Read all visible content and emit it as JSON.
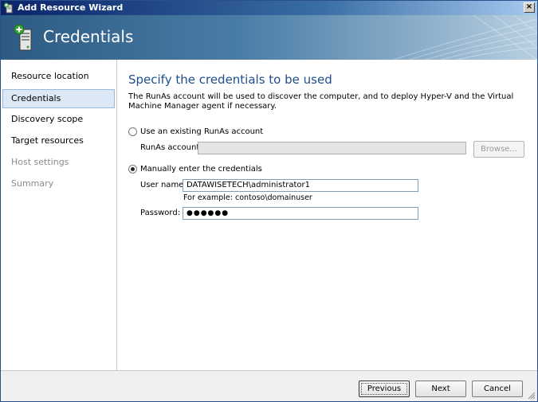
{
  "window": {
    "title": "Add Resource Wizard",
    "close_glyph": "×",
    "icon": "server-add-icon"
  },
  "header": {
    "title": "Credentials",
    "icon": "server-add-icon"
  },
  "sidebar": {
    "items": [
      {
        "label": "Resource location",
        "state": "normal"
      },
      {
        "label": "Credentials",
        "state": "selected"
      },
      {
        "label": "Discovery scope",
        "state": "normal"
      },
      {
        "label": "Target resources",
        "state": "normal"
      },
      {
        "label": "Host settings",
        "state": "disabled"
      },
      {
        "label": "Summary",
        "state": "disabled"
      }
    ]
  },
  "main": {
    "title": "Specify the credentials to be used",
    "description": "The RunAs account will be used to discover the computer, and to deploy Hyper-V and the Virtual Machine Manager agent if necessary.",
    "option_existing": {
      "label": "Use an existing RunAs account",
      "checked": false
    },
    "runas_account": {
      "label": "RunAs account:",
      "value": ""
    },
    "browse_label": "Browse...",
    "option_manual": {
      "label": "Manually enter the credentials",
      "checked": true
    },
    "user_name": {
      "label": "User name:",
      "value": "DATAWISETECH\\administrator1",
      "example": "For example: contoso\\domainuser"
    },
    "password": {
      "label": "Password:",
      "value": "●●●●●●"
    }
  },
  "footer": {
    "previous_label": "Previous",
    "next_label": "Next",
    "cancel_label": "Cancel"
  },
  "colors": {
    "title_bar": "#0a246a",
    "heading_blue": "#1f4e8c",
    "selected_nav_bg": "#dce8f5"
  }
}
